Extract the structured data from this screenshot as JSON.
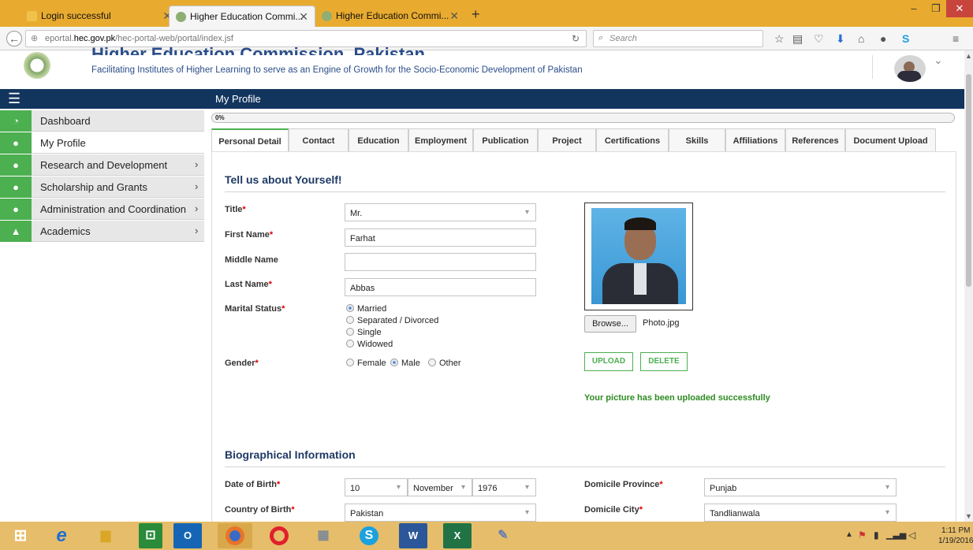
{
  "browser": {
    "tabs": [
      {
        "label": "Login successful"
      },
      {
        "label": "Higher Education Commi..."
      },
      {
        "label": "Higher Education Commi..."
      }
    ],
    "url_prefix": "eportal.",
    "url_domain": "hec.gov.pk",
    "url_path": "/hec-portal-web/portal/index.jsf",
    "search_placeholder": "Search"
  },
  "header": {
    "title": "Higher Education Commission, Pakistan",
    "tagline": "Facilitating Institutes of Higher Learning to serve as an Engine of Growth for the Socio-Economic Development of Pakistan"
  },
  "sidebar": {
    "items": [
      {
        "label": "Dashboard",
        "icon": "dashboard-icon"
      },
      {
        "label": "My Profile",
        "icon": "user-icon"
      },
      {
        "label": "Research and Development",
        "icon": "user-icon"
      },
      {
        "label": "Scholarship and Grants",
        "icon": "user-icon"
      },
      {
        "label": "Administration and Coordination",
        "icon": "user-icon"
      },
      {
        "label": "Academics",
        "icon": "graduation-cap-icon"
      }
    ]
  },
  "main": {
    "page_title": "My Profile",
    "progress_text": "0%",
    "progress": 0,
    "tabs": [
      "Personal Detail",
      "Contact",
      "Education",
      "Employment",
      "Publication",
      "Project",
      "Certifications",
      "Skills",
      "Affiliations",
      "References",
      "Document Upload"
    ],
    "section1_title": "Tell us about Yourself!",
    "form": {
      "title_label": "Title",
      "title_value": "Mr.",
      "first_name_label": "First Name",
      "first_name_value": "Farhat",
      "middle_name_label": "Middle Name",
      "middle_name_value": "",
      "last_name_label": "Last Name",
      "last_name_value": "Abbas",
      "marital_label": "Marital Status",
      "marital_options": [
        "Married",
        "Separated / Divorced",
        "Single",
        "Widowed"
      ],
      "marital_selected": "Married",
      "gender_label": "Gender",
      "gender_options": [
        "Female",
        "Male",
        "Other"
      ],
      "gender_selected": "Male"
    },
    "photo": {
      "browse_label": "Browse...",
      "file_name": "Photo.jpg",
      "upload_label": "UPLOAD",
      "delete_label": "DELETE",
      "message": "Your picture has been uploaded successfully"
    },
    "section2_title": "Biographical Information",
    "bio": {
      "dob_label": "Date of Birth",
      "dob_day": "10",
      "dob_month": "November",
      "dob_year": "1976",
      "country_label": "Country of Birth",
      "country_value": "Pakistan",
      "domicile_province_label": "Domicile Province",
      "domicile_province_value": "Punjab",
      "domicile_city_label": "Domicile City",
      "domicile_city_value": "Tandlianwala"
    }
  },
  "taskbar": {
    "time": "1:11 PM",
    "date": "1/19/2016"
  },
  "colors": {
    "accent_green": "#4caf50",
    "nav_blue": "#12355e",
    "title_blue": "#2a4d8a",
    "browser_orange": "#e9ab2f",
    "required_red": "#dd0000"
  }
}
